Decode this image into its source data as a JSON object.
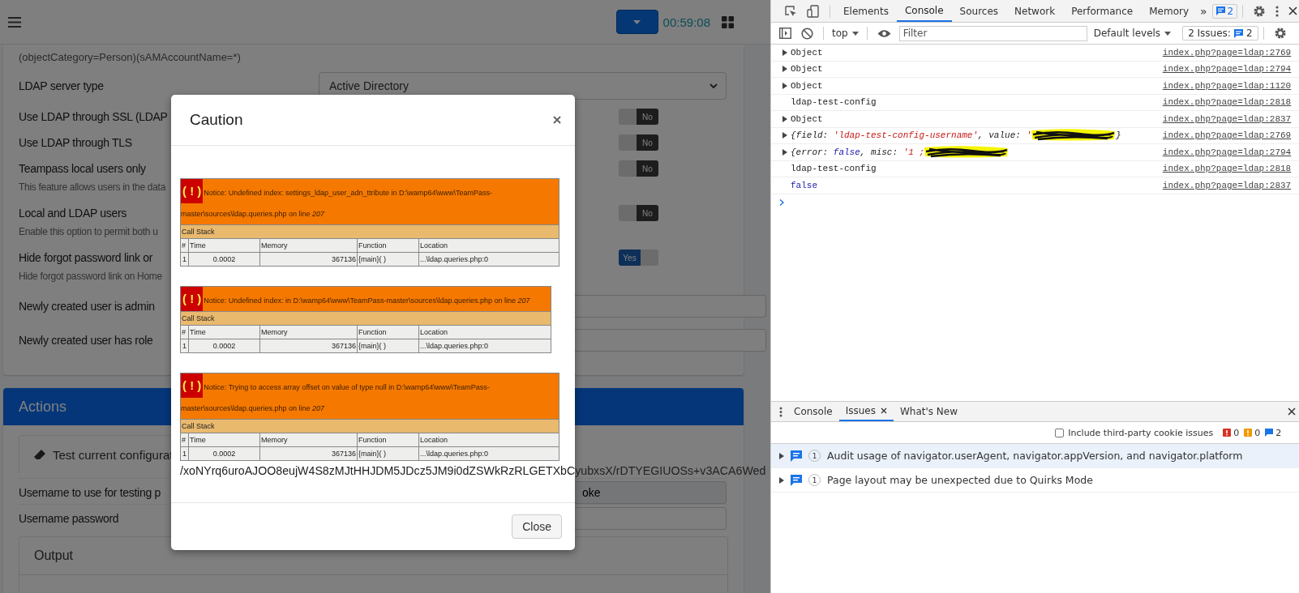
{
  "page": {
    "header": {
      "timer": "00:59:08"
    },
    "settings_intro": "(objectCategory=Person)(sAMAccountName=*)",
    "settings": [
      {
        "kind": "select",
        "label": "LDAP server type",
        "value": "Active Directory"
      },
      {
        "kind": "toggle",
        "label": "Use LDAP through SSL (LDAP",
        "on": false,
        "toggle_label": "No"
      },
      {
        "kind": "toggle",
        "label": "Use LDAP through TLS",
        "on": false,
        "toggle_label": "No"
      },
      {
        "kind": "toggle",
        "label": "Teampass local users only",
        "description": "This feature allows users in the data",
        "on": false,
        "toggle_label": "No"
      },
      {
        "kind": "toggle",
        "label": "Local and LDAP users",
        "description": "Enable this option to permit both u",
        "on": false,
        "toggle_label": "No"
      },
      {
        "kind": "toggle",
        "label": "Hide forgot password link or",
        "description": "Hide forgot password link on Home",
        "on": true,
        "toggle_label": "Yes"
      },
      {
        "kind": "field",
        "label": "Newly created user is admin"
      },
      {
        "kind": "field",
        "label": "Newly created user has role"
      }
    ],
    "actions": {
      "title": "Actions",
      "tab": "Test current configurat",
      "fields": [
        {
          "label": "Username to use for testing p",
          "value": "oke"
        },
        {
          "label": "Username password"
        }
      ],
      "output_title": "Output"
    }
  },
  "modal": {
    "title": "Caution",
    "notices": [
      {
        "icon_text": "( ! )",
        "message": "Notice: Undefined index: settings_ldap_user_adn_ttribute in D:\\wamp64\\www\\TeamPass-master\\sources\\ldap.queries.php on line *207*",
        "stack_title": "Call Stack",
        "columns": [
          "#",
          "Time",
          "Memory",
          "Function",
          "Location"
        ],
        "rows": [
          [
            "1",
            "0.0002",
            "367136",
            "{main}( )",
            "...\\ldap.queries.php:0"
          ]
        ]
      },
      {
        "icon_text": "( ! )",
        "message": "Notice: Undefined index: in D:\\wamp64\\www\\TeamPass-master\\sources\\ldap.queries.php on line *207*",
        "stack_title": "Call Stack",
        "columns": [
          "#",
          "Time",
          "Memory",
          "Function",
          "Location"
        ],
        "rows": [
          [
            "1",
            "0.0002",
            "367136",
            "{main}( )",
            "...\\ldap.queries.php:0"
          ]
        ]
      },
      {
        "icon_text": "( ! )",
        "message": "Notice: Trying to access array offset on value of type null in D:\\wamp64\\www\\TeamPass-master\\sources\\ldap.queries.php on line *207*",
        "stack_title": "Call Stack",
        "columns": [
          "#",
          "Time",
          "Memory",
          "Function",
          "Location"
        ],
        "rows": [
          [
            "1",
            "0.0002",
            "367136",
            "{main}( )",
            "...\\ldap.queries.php:0"
          ]
        ]
      }
    ],
    "output_text": "/xoNYrq6uroAJOO8eujW4S8zMJtHHJDM5JDcz5JM9i0dZSWkRzRLGETXbCyubxsX/rDTYEGIUOSs+v3ACA6Wed",
    "close_button": "Close"
  },
  "devtools": {
    "tabs": [
      {
        "label": "Elements",
        "selected": false
      },
      {
        "label": "Console",
        "selected": true
      },
      {
        "label": "Sources",
        "selected": false
      },
      {
        "label": "Network",
        "selected": false
      },
      {
        "label": "Performance",
        "selected": false
      },
      {
        "label": "Memory",
        "selected": false
      }
    ],
    "more_tabs": "»",
    "issues_badge": "2",
    "context": "top",
    "filter_placeholder": "Filter",
    "levels": "Default levels",
    "issues_label": "2 Issues:",
    "issues_count": "2",
    "messages": [
      {
        "kind": "object",
        "text": "Object",
        "expanded": false,
        "source": "index.php?page=ldap:2769"
      },
      {
        "kind": "object",
        "text": "Object",
        "expanded": false,
        "source": "index.php?page=ldap:2794"
      },
      {
        "kind": "object",
        "text": "Object",
        "expanded": false,
        "source": "index.php?page=ldap:1120"
      },
      {
        "kind": "text",
        "text": "ldap-test-config",
        "source": "index.php?page=ldap:2818"
      },
      {
        "kind": "object",
        "text": "Object",
        "expanded": false,
        "source": "index.php?page=ldap:2837"
      },
      {
        "kind": "preview",
        "expanded": false,
        "parts": [
          {
            "kind": "key",
            "text": "{field: "
          },
          {
            "kind": "string",
            "text": "'ldap-test-config-username'"
          },
          {
            "kind": "key",
            "text": ", value: "
          },
          {
            "kind": "string",
            "text": "'"
          }
        ],
        "redacted": true,
        "tail": "}",
        "source": "index.php?page=ldap:2769"
      },
      {
        "kind": "preview",
        "expanded": false,
        "parts": [
          {
            "kind": "key",
            "text": "{error: "
          },
          {
            "kind": "keyword",
            "text": "false"
          },
          {
            "kind": "key",
            "text": ", misc: "
          },
          {
            "kind": "string",
            "text": "'1 ;"
          }
        ],
        "redacted": true,
        "source": "index.php?page=ldap:2794"
      },
      {
        "kind": "text",
        "text": "ldap-test-config",
        "source": "index.php?page=ldap:2818"
      },
      {
        "kind": "keyword",
        "text": "false",
        "source": "index.php?page=ldap:2837"
      }
    ],
    "drawer": {
      "tabs": [
        {
          "label": "Console",
          "selected": false,
          "closable": false
        },
        {
          "label": "Issues",
          "selected": true,
          "closable": true
        },
        {
          "label": "What's New",
          "selected": false,
          "closable": false
        }
      ],
      "third_party_label": "Include third-party cookie issues",
      "third_party_checked": false,
      "counts": [
        {
          "kind": "error",
          "count": "0"
        },
        {
          "kind": "warning",
          "count": "0"
        },
        {
          "kind": "info",
          "count": "2"
        }
      ],
      "issues": [
        {
          "count": "1",
          "text": "Audit usage of navigator.userAgent, navigator.appVersion, and navigator.platform",
          "expanded": false,
          "selected": true
        },
        {
          "count": "1",
          "text": "Page layout may be unexpected due to Quirks Mode",
          "expanded": false,
          "selected": false
        }
      ]
    }
  }
}
